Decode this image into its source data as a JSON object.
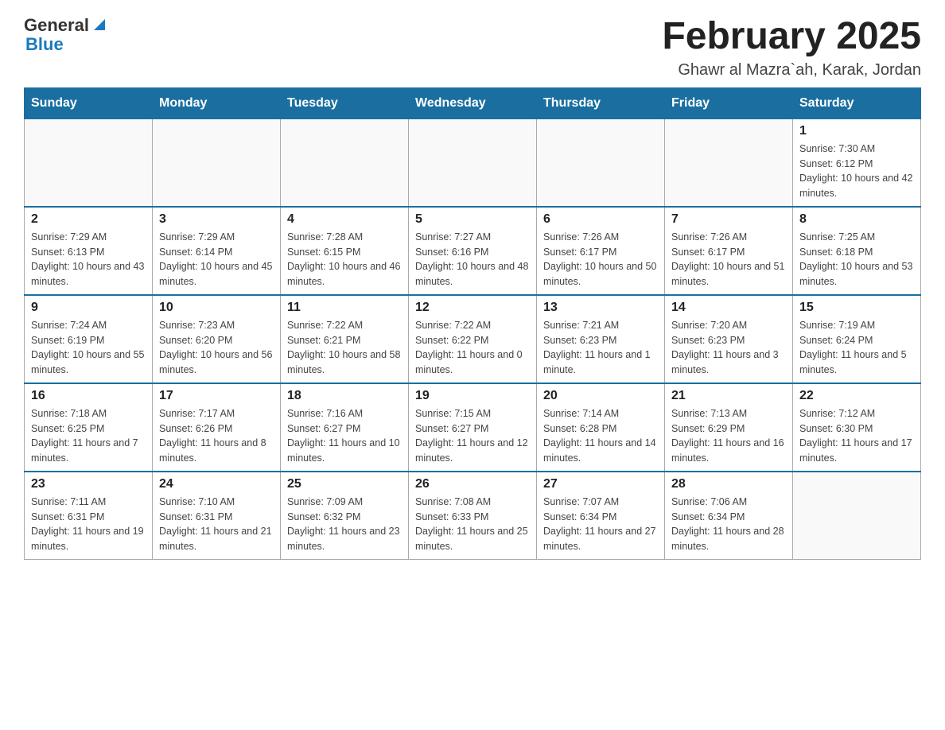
{
  "header": {
    "logo_general": "General",
    "logo_blue": "Blue",
    "title": "February 2025",
    "subtitle": "Ghawr al Mazra`ah, Karak, Jordan"
  },
  "days_of_week": [
    "Sunday",
    "Monday",
    "Tuesday",
    "Wednesday",
    "Thursday",
    "Friday",
    "Saturday"
  ],
  "weeks": [
    [
      {
        "day": "",
        "info": ""
      },
      {
        "day": "",
        "info": ""
      },
      {
        "day": "",
        "info": ""
      },
      {
        "day": "",
        "info": ""
      },
      {
        "day": "",
        "info": ""
      },
      {
        "day": "",
        "info": ""
      },
      {
        "day": "1",
        "info": "Sunrise: 7:30 AM\nSunset: 6:12 PM\nDaylight: 10 hours and 42 minutes."
      }
    ],
    [
      {
        "day": "2",
        "info": "Sunrise: 7:29 AM\nSunset: 6:13 PM\nDaylight: 10 hours and 43 minutes."
      },
      {
        "day": "3",
        "info": "Sunrise: 7:29 AM\nSunset: 6:14 PM\nDaylight: 10 hours and 45 minutes."
      },
      {
        "day": "4",
        "info": "Sunrise: 7:28 AM\nSunset: 6:15 PM\nDaylight: 10 hours and 46 minutes."
      },
      {
        "day": "5",
        "info": "Sunrise: 7:27 AM\nSunset: 6:16 PM\nDaylight: 10 hours and 48 minutes."
      },
      {
        "day": "6",
        "info": "Sunrise: 7:26 AM\nSunset: 6:17 PM\nDaylight: 10 hours and 50 minutes."
      },
      {
        "day": "7",
        "info": "Sunrise: 7:26 AM\nSunset: 6:17 PM\nDaylight: 10 hours and 51 minutes."
      },
      {
        "day": "8",
        "info": "Sunrise: 7:25 AM\nSunset: 6:18 PM\nDaylight: 10 hours and 53 minutes."
      }
    ],
    [
      {
        "day": "9",
        "info": "Sunrise: 7:24 AM\nSunset: 6:19 PM\nDaylight: 10 hours and 55 minutes."
      },
      {
        "day": "10",
        "info": "Sunrise: 7:23 AM\nSunset: 6:20 PM\nDaylight: 10 hours and 56 minutes."
      },
      {
        "day": "11",
        "info": "Sunrise: 7:22 AM\nSunset: 6:21 PM\nDaylight: 10 hours and 58 minutes."
      },
      {
        "day": "12",
        "info": "Sunrise: 7:22 AM\nSunset: 6:22 PM\nDaylight: 11 hours and 0 minutes."
      },
      {
        "day": "13",
        "info": "Sunrise: 7:21 AM\nSunset: 6:23 PM\nDaylight: 11 hours and 1 minute."
      },
      {
        "day": "14",
        "info": "Sunrise: 7:20 AM\nSunset: 6:23 PM\nDaylight: 11 hours and 3 minutes."
      },
      {
        "day": "15",
        "info": "Sunrise: 7:19 AM\nSunset: 6:24 PM\nDaylight: 11 hours and 5 minutes."
      }
    ],
    [
      {
        "day": "16",
        "info": "Sunrise: 7:18 AM\nSunset: 6:25 PM\nDaylight: 11 hours and 7 minutes."
      },
      {
        "day": "17",
        "info": "Sunrise: 7:17 AM\nSunset: 6:26 PM\nDaylight: 11 hours and 8 minutes."
      },
      {
        "day": "18",
        "info": "Sunrise: 7:16 AM\nSunset: 6:27 PM\nDaylight: 11 hours and 10 minutes."
      },
      {
        "day": "19",
        "info": "Sunrise: 7:15 AM\nSunset: 6:27 PM\nDaylight: 11 hours and 12 minutes."
      },
      {
        "day": "20",
        "info": "Sunrise: 7:14 AM\nSunset: 6:28 PM\nDaylight: 11 hours and 14 minutes."
      },
      {
        "day": "21",
        "info": "Sunrise: 7:13 AM\nSunset: 6:29 PM\nDaylight: 11 hours and 16 minutes."
      },
      {
        "day": "22",
        "info": "Sunrise: 7:12 AM\nSunset: 6:30 PM\nDaylight: 11 hours and 17 minutes."
      }
    ],
    [
      {
        "day": "23",
        "info": "Sunrise: 7:11 AM\nSunset: 6:31 PM\nDaylight: 11 hours and 19 minutes."
      },
      {
        "day": "24",
        "info": "Sunrise: 7:10 AM\nSunset: 6:31 PM\nDaylight: 11 hours and 21 minutes."
      },
      {
        "day": "25",
        "info": "Sunrise: 7:09 AM\nSunset: 6:32 PM\nDaylight: 11 hours and 23 minutes."
      },
      {
        "day": "26",
        "info": "Sunrise: 7:08 AM\nSunset: 6:33 PM\nDaylight: 11 hours and 25 minutes."
      },
      {
        "day": "27",
        "info": "Sunrise: 7:07 AM\nSunset: 6:34 PM\nDaylight: 11 hours and 27 minutes."
      },
      {
        "day": "28",
        "info": "Sunrise: 7:06 AM\nSunset: 6:34 PM\nDaylight: 11 hours and 28 minutes."
      },
      {
        "day": "",
        "info": ""
      }
    ]
  ]
}
